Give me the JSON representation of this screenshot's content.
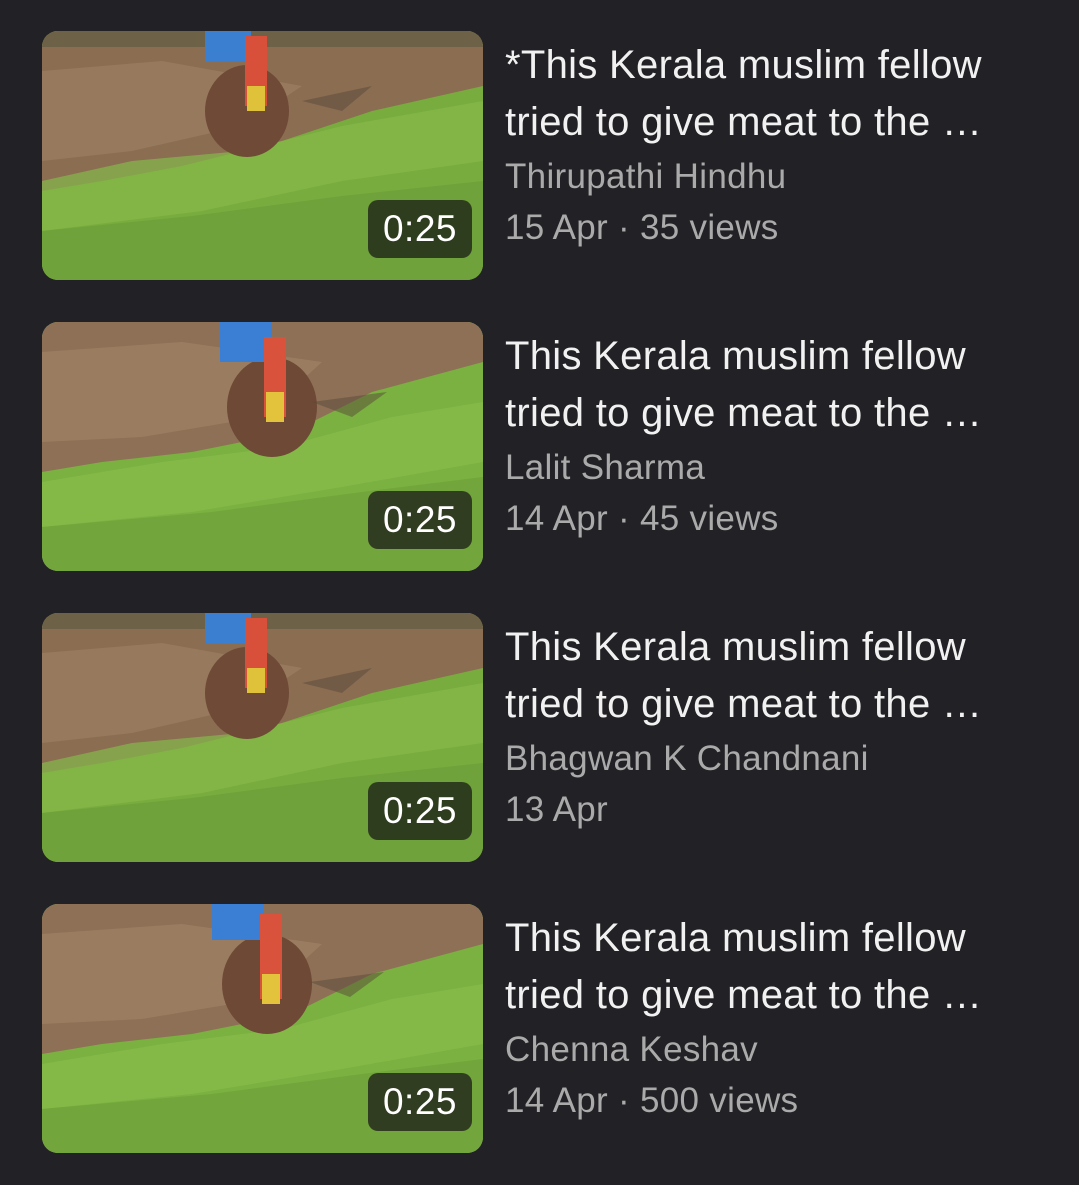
{
  "videos": [
    {
      "title_line1": "*This Kerala muslim fellow",
      "title_line2": "tried to give meat to the …",
      "channel": "Thirupathi Hindhu",
      "stats": "15 Apr · 35 views",
      "duration": "0:25"
    },
    {
      "title_line1": "This Kerala muslim fellow",
      "title_line2": "tried to give meat to the …",
      "channel": "Lalit Sharma",
      "stats": "14 Apr · 45 views",
      "duration": "0:25"
    },
    {
      "title_line1": "This Kerala muslim fellow",
      "title_line2": "tried to give meat to the …",
      "channel": "Bhagwan K Chandnani",
      "stats": "13 Apr",
      "duration": "0:25"
    },
    {
      "title_line1": "This Kerala muslim fellow",
      "title_line2": "tried to give meat to the …",
      "channel": "Chenna Keshav",
      "stats": "14 Apr · 500 views",
      "duration": "0:25"
    }
  ],
  "colors": {
    "background": "#222226",
    "title_text": "#f1f1f1",
    "secondary_text": "#aaaaaa",
    "grass": "#7fb042",
    "dirt": "#8a6a4c"
  }
}
